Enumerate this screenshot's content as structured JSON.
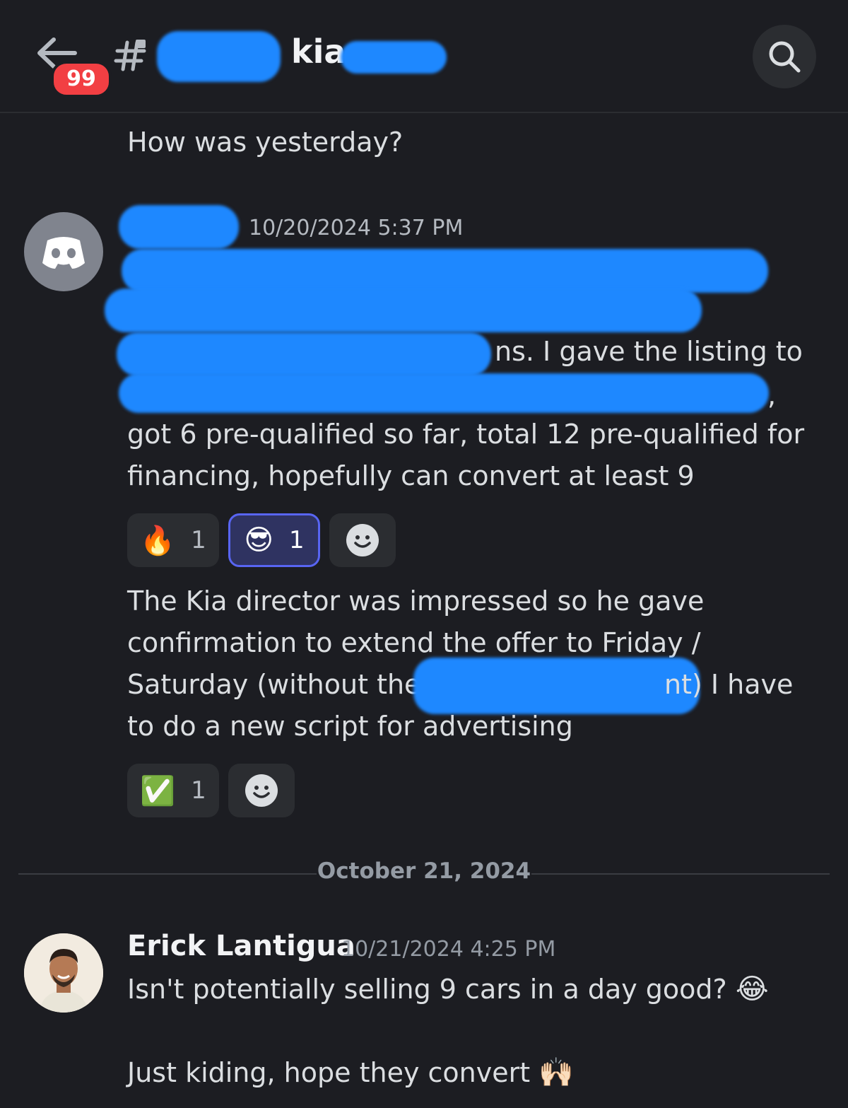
{
  "header": {
    "unread_badge": "99",
    "channel_name": "kia-",
    "back_icon": "back-arrow-icon",
    "channel_icon": "locked-hash-icon",
    "search_icon": "search-icon"
  },
  "messages": {
    "prev_text": "How was yesterday?",
    "msg1": {
      "timestamp": "10/20/2024 5:37 PM",
      "avatar_icon": "discord-logo-icon",
      "line_partial_1": "ns. I gave the listing to",
      "line_partial_2": ",",
      "line3": "got 6 pre-qualified so far, total 12 pre-qualified for",
      "line4": "financing, hopefully can convert at least 9",
      "reactions": [
        {
          "emoji": "🔥",
          "count": "1"
        },
        {
          "emoji": "😎",
          "count": "1"
        }
      ]
    },
    "msg2": {
      "line1": "The Kia director was impressed so he gave",
      "line2": "confirmation to extend the offer to Friday /",
      "line3a": "Saturday (without the",
      "line3b": "nt) I have",
      "line4": "to do a new script for advertising",
      "reactions": [
        {
          "emoji": "✅",
          "count": "1"
        }
      ]
    },
    "date_divider": "October 21, 2024",
    "msg3": {
      "author": "Erick Lantigua",
      "timestamp": "10/21/2024 4:25 PM",
      "line1": "Isn't potentially selling 9 cars in a day good?",
      "emoji1": "😂",
      "line2": "Just kiding, hope they convert",
      "emoji2": "🙌🏻"
    }
  },
  "colors": {
    "background": "#1c1d22",
    "redaction": "#1e88ff",
    "badge": "#f23f43",
    "selected_reaction": "#5865f2"
  }
}
